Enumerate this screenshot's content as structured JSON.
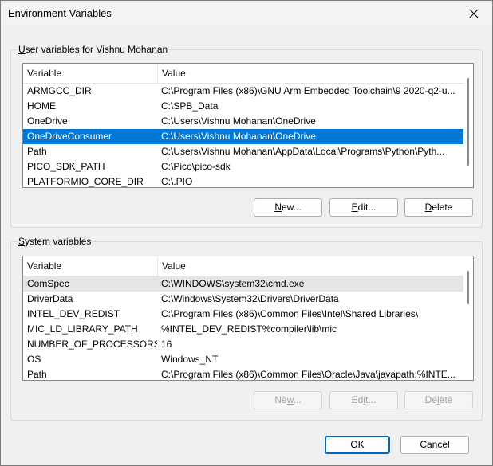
{
  "window": {
    "title": "Environment Variables"
  },
  "user_section": {
    "label_prefix": "U",
    "label_rest": "ser variables for Vishnu Mohanan",
    "columns": [
      "Variable",
      "Value"
    ],
    "rows": [
      {
        "variable": "ARMGCC_DIR",
        "value": "C:\\Program Files (x86)\\GNU Arm Embedded Toolchain\\9 2020-q2-u..."
      },
      {
        "variable": "HOME",
        "value": "C:\\SPB_Data"
      },
      {
        "variable": "OneDrive",
        "value": "C:\\Users\\Vishnu Mohanan\\OneDrive"
      },
      {
        "variable": "OneDriveConsumer",
        "value": "C:\\Users\\Vishnu Mohanan\\OneDrive"
      },
      {
        "variable": "Path",
        "value": "C:\\Users\\Vishnu Mohanan\\AppData\\Local\\Programs\\Python\\Pyth..."
      },
      {
        "variable": "PICO_SDK_PATH",
        "value": "C:\\Pico\\pico-sdk"
      },
      {
        "variable": "PLATFORMIO_CORE_DIR",
        "value": "C:\\.PIO"
      }
    ],
    "selected_index": 3,
    "buttons": {
      "new": {
        "u": "N",
        "rest": "ew..."
      },
      "edit": {
        "u": "E",
        "rest": "dit..."
      },
      "delete": {
        "u": "D",
        "rest": "elete"
      }
    }
  },
  "system_section": {
    "label_prefix": "S",
    "label_rest": "ystem variables",
    "columns": [
      "Variable",
      "Value"
    ],
    "rows": [
      {
        "variable": "ComSpec",
        "value": "C:\\WINDOWS\\system32\\cmd.exe"
      },
      {
        "variable": "DriverData",
        "value": "C:\\Windows\\System32\\Drivers\\DriverData"
      },
      {
        "variable": "INTEL_DEV_REDIST",
        "value": "C:\\Program Files (x86)\\Common Files\\Intel\\Shared Libraries\\"
      },
      {
        "variable": "MIC_LD_LIBRARY_PATH",
        "value": "%INTEL_DEV_REDIST%compiler\\lib\\mic"
      },
      {
        "variable": "NUMBER_OF_PROCESSORS",
        "value": "16"
      },
      {
        "variable": "OS",
        "value": "Windows_NT"
      },
      {
        "variable": "Path",
        "value": "C:\\Program Files (x86)\\Common Files\\Oracle\\Java\\javapath;%INTE..."
      }
    ],
    "hover_index": 0,
    "buttons": {
      "new": {
        "u": "w",
        "pre": "Ne",
        "rest": "..."
      },
      "edit": {
        "u": "i",
        "pre": "Ed",
        "rest": "t..."
      },
      "delete": {
        "u": "l",
        "pre": "De",
        "rest": "ete"
      }
    }
  },
  "footer": {
    "ok": "OK",
    "cancel": "Cancel"
  },
  "colors": {
    "selection": "#0078d7",
    "hover": "#e5e5e5"
  },
  "icons": {
    "close": "close-icon"
  }
}
